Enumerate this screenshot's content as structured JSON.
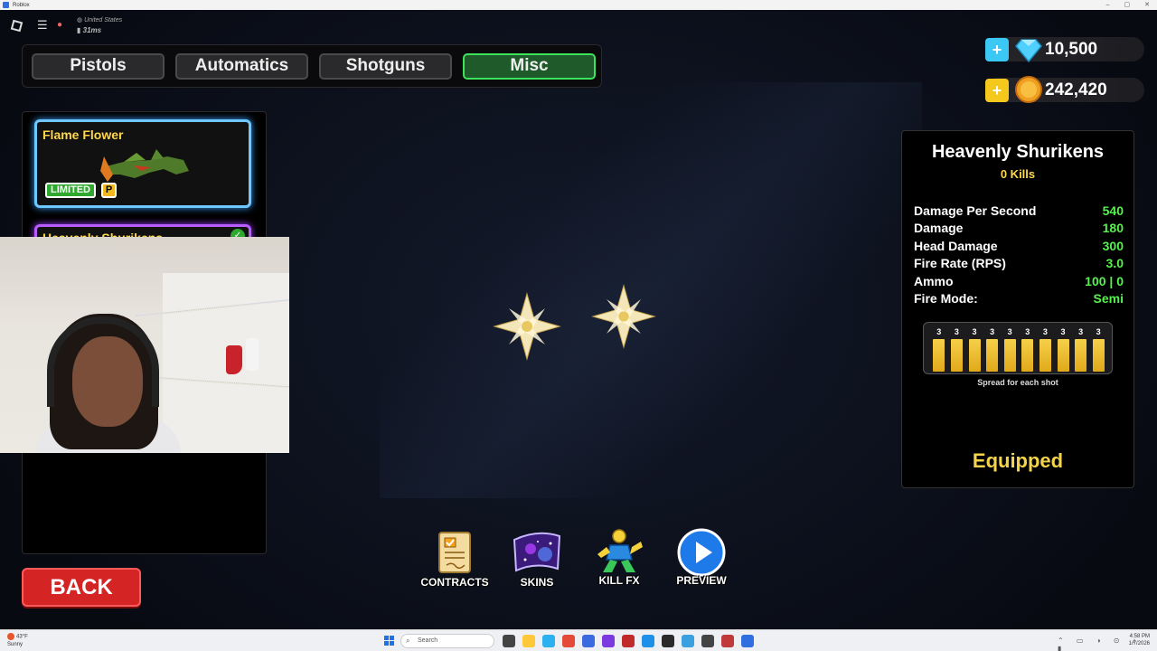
{
  "window": {
    "title": "Roblox",
    "controls": [
      "–",
      "▢",
      "✕"
    ]
  },
  "network": {
    "region": "United States",
    "ping": "31ms"
  },
  "tabs": [
    {
      "label": "Pistols",
      "active": false
    },
    {
      "label": "Automatics",
      "active": false
    },
    {
      "label": "Shotguns",
      "active": false
    },
    {
      "label": "Misc",
      "active": true
    }
  ],
  "items": [
    {
      "name": "Flame Flower",
      "badge": "LIMITED",
      "tag": "P"
    },
    {
      "name": "Heavenly Shurikens",
      "equipped": true
    }
  ],
  "currency": {
    "gems": {
      "value": "10,500",
      "plus": "+"
    },
    "coins": {
      "value": "242,420",
      "plus": "+"
    }
  },
  "weapon": {
    "name": "Heavenly Shurikens",
    "kills": "0 Kills",
    "stats": [
      {
        "label": "Damage Per Second",
        "value": "540"
      },
      {
        "label": "Damage",
        "value": "180"
      },
      {
        "label": "Head Damage",
        "value": "300"
      },
      {
        "label": "Fire Rate (RPS)",
        "value": "3.0"
      },
      {
        "label": "Ammo",
        "value": "100 | 0"
      },
      {
        "label": "Fire Mode:",
        "value": "Semi"
      }
    ],
    "spread_values": [
      "3",
      "3",
      "3",
      "3",
      "3",
      "3",
      "3",
      "3",
      "3",
      "3"
    ],
    "spread_label": "Spread for each shot",
    "status": "Equipped"
  },
  "actions": [
    {
      "label": "CONTRACTS",
      "icon": "contract-icon"
    },
    {
      "label": "SKINS",
      "icon": "skins-icon"
    },
    {
      "label": "KILL FX",
      "icon": "kill-fx-icon"
    },
    {
      "label": "PREVIEW",
      "icon": "play-icon"
    }
  ],
  "back_label": "BACK",
  "taskbar": {
    "weather_temp": "43°F",
    "weather_desc": "Sunny",
    "search_placeholder": "Search",
    "time": "4:58 PM",
    "date": "1/7/2026"
  },
  "colors": {
    "active_tab": "#3ee35c",
    "stat_value": "#57f04e",
    "gold": "#ffd84a",
    "back": "#d42424"
  }
}
